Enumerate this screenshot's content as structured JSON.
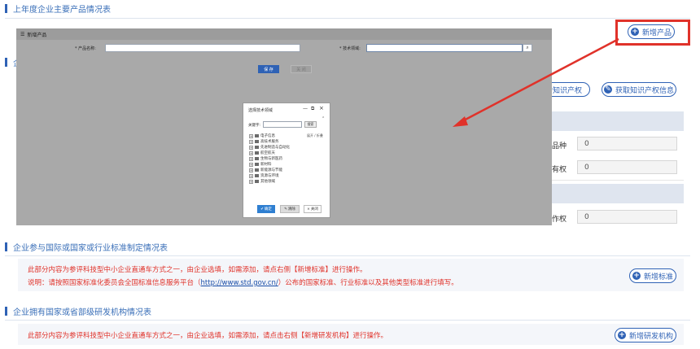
{
  "sections": {
    "products": {
      "title": "上年度企业主要产品情况表",
      "add_button": "新增产品"
    },
    "ip": {
      "title_fragment": "企",
      "buttons": {
        "add_ip": "增知识产权",
        "get_ip": "获取知识产权信息"
      }
    },
    "ip_fields": [
      {
        "label": "品种",
        "value": "0"
      },
      {
        "label": "有权",
        "value": "0"
      },
      {
        "label": "作权",
        "value": "0"
      }
    ],
    "standards": {
      "title": "企业参与国际或国家或行业标准制定情况表",
      "note1": "此部分内容为参评科技型中小企业直通车方式之一，由企业选填，如需添加，请点右侧【新增标准】进行操作。",
      "note2_prefix": "说明：请按照国家标准化委员会全国标准信息服务平台（",
      "note2_link": "http://www.std.gov.cn/",
      "note2_suffix": "）公布的国家标准、行业标准以及其他类型标准进行填写。",
      "add_button": "新增标准"
    },
    "rd": {
      "title": "企业拥有国家或省部级研发机构情况表",
      "note": "此部分内容为参评科技型中小企业直通车方式之一，由企业选填，如需添加，请点击右侧【新增研发机构】进行操作。",
      "add_button": "新增研发机构"
    }
  },
  "modal": {
    "title": "新增产品",
    "product_name_label": "* 产品名称:",
    "tech_field_label": "* 技术领域:",
    "confirm": "保 存",
    "cancel": "关 闭"
  },
  "dialog": {
    "title": "选择技术领域",
    "keyword_label": "关键字:",
    "search_button": "搜索",
    "expand_collapse": "展开 / 折叠",
    "tree": [
      "电子信息",
      "高技术服务",
      "先进制造与自动化",
      "航空航天",
      "生物与新医药",
      "新材料",
      "新能源与节能",
      "资源与环境",
      "其他领域"
    ],
    "ok": "确定",
    "clear": "清除",
    "close": "关闭"
  },
  "colors": {
    "accent": "#2f62b5",
    "annotation_red": "#e0322a",
    "overlay": "#a9a9a9"
  },
  "annotation": {
    "type": "red box and arrow pointing to add-product button"
  }
}
